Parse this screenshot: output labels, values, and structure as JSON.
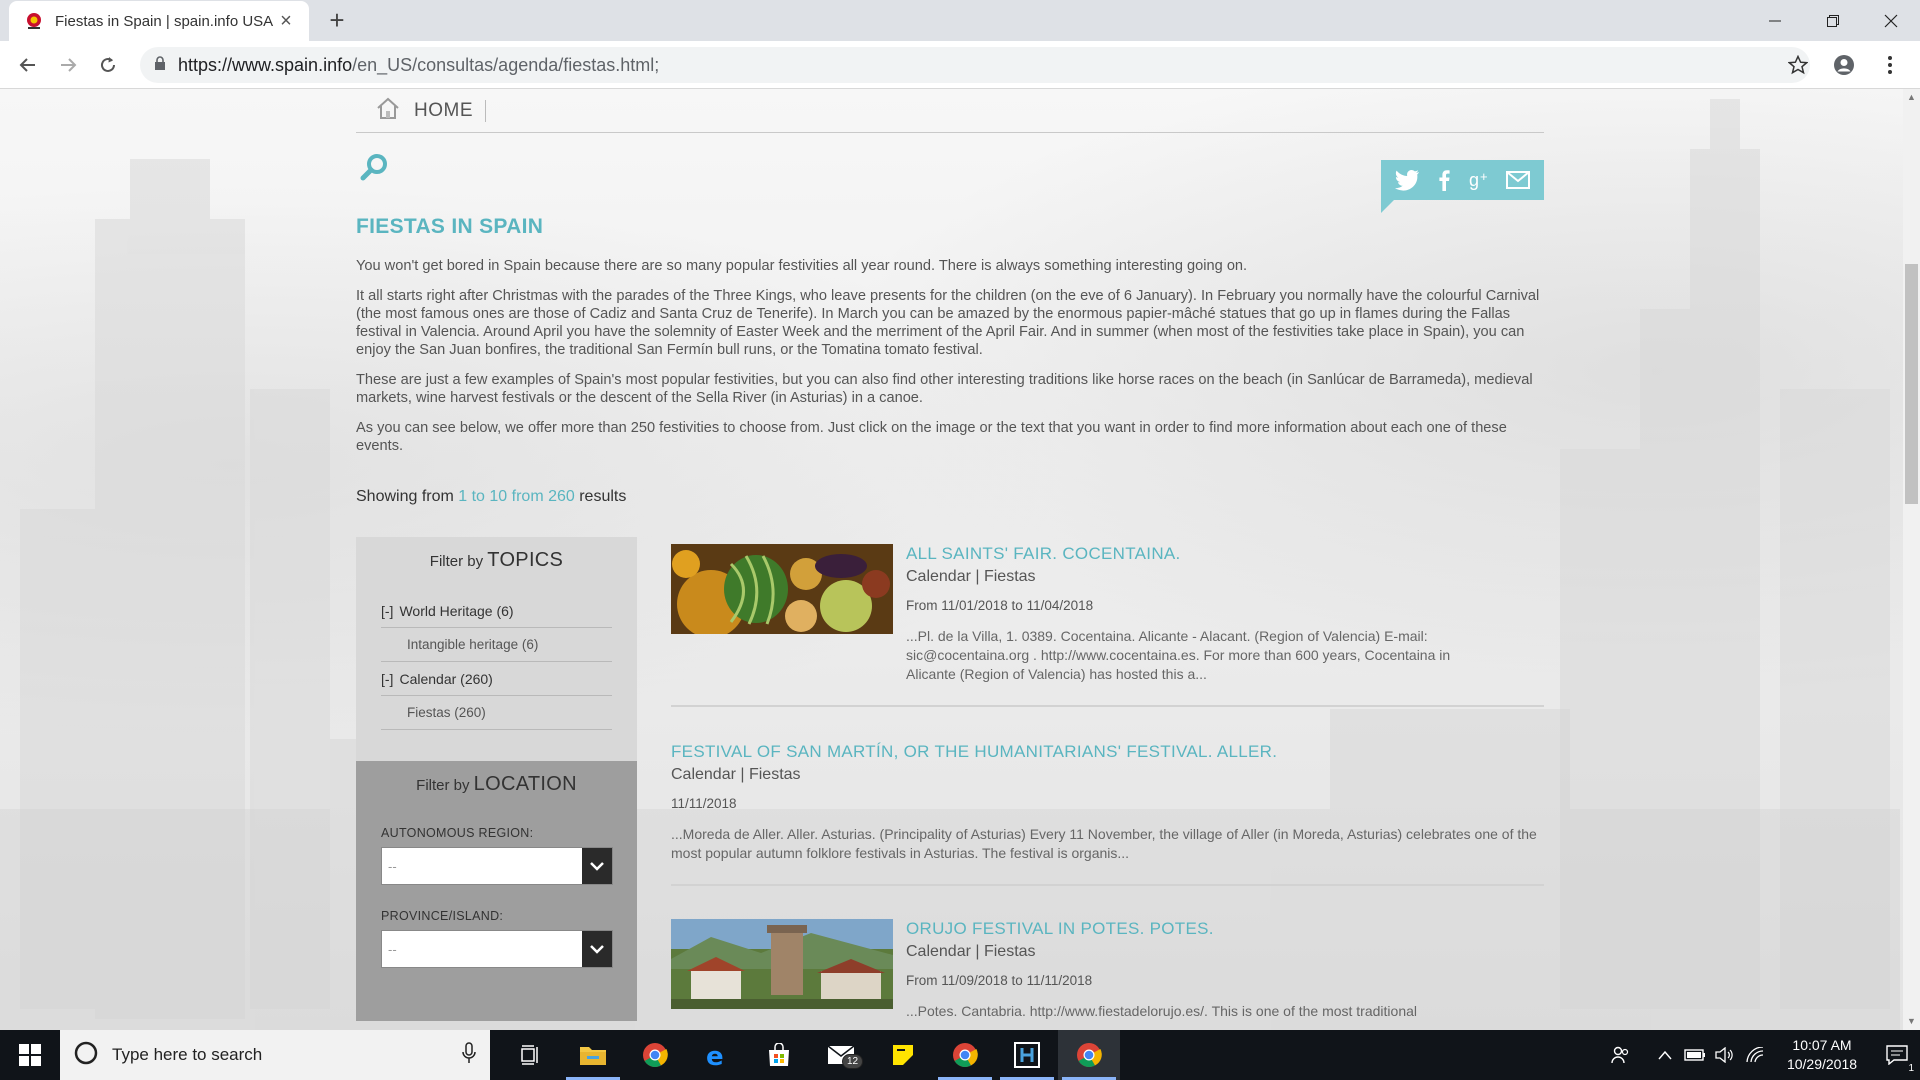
{
  "browser": {
    "tab_title": "Fiestas in Spain | spain.info USA",
    "new_tab_symbol": "+",
    "url_host": "https://www.spain.info",
    "url_path": "/en_US/consultas/agenda/fiestas.html;"
  },
  "nav": {
    "home_label": "HOME"
  },
  "page": {
    "title": "FIESTAS IN SPAIN",
    "paragraphs": [
      "You won't get bored in Spain because there are so many popular festivities all year round. There is always something interesting going on.",
      "It all starts right after Christmas with the parades of the Three Kings, who leave presents for the children (on the eve of 6 January). In February you normally have the colourful Carnival (the most famous ones are those of Cadiz and Santa Cruz de Tenerife). In March you can be amazed by the enormous papier-mâché statues that go up in flames during the Fallas festival in Valencia. Around April you have the solemnity of Easter Week and the merriment of the April Fair. And in summer (when most of the festivities take place in Spain), you can enjoy the San Juan bonfires, the traditional San Fermín bull runs, or the Tomatina tomato festival.",
      "These are just a few examples of Spain's most popular festivities, but you can also find other interesting traditions like horse races on the beach (in Sanlúcar de Barrameda), medieval markets, wine harvest festivals or the descent of the Sella River (in Asturias) in a canoe.",
      "As you can see below, we offer more than 250 festivities to choose from. Just click on the image or the text that you want in order to find more information about each one of these events."
    ],
    "showing_prefix": "Showing from ",
    "showing_range": "1 to 10 from 260",
    "showing_suffix": " results"
  },
  "filters": {
    "topics_prefix": "Filter by ",
    "topics_title": "TOPICS",
    "topic_items": [
      {
        "toggle": "[-]",
        "label": "World Heritage (6)"
      },
      {
        "label": "Intangible heritage (6)"
      },
      {
        "toggle": "[-]",
        "label": "Calendar (260)"
      },
      {
        "label": "Fiestas (260)"
      }
    ],
    "location_prefix": "Filter by ",
    "location_title": "LOCATION",
    "region_label": "AUTONOMOUS REGION:",
    "region_value": "--",
    "province_label": "PROVINCE/ISLAND:",
    "province_value": "--"
  },
  "results": [
    {
      "title": "ALL SAINTS' FAIR. COCENTAINA.",
      "category": "Calendar  |  Fiestas",
      "date": "From 11/01/2018 to 11/04/2018",
      "text": "...Pl. de la Villa, 1. 0389. Cocentaina. Alicante - Alacant. (Region of Valencia) E-mail: sic@cocentaina.org . http://www.cocentaina.es. For more than 600 years, Cocentaina in Alicante (Region of Valencia) has hosted this a..."
    },
    {
      "title": "FESTIVAL OF SAN MARTÍN, OR THE HUMANITARIANS' FESTIVAL. ALLER.",
      "category": "Calendar  |  Fiestas",
      "date": "11/11/2018",
      "text": "...Moreda de Aller. Aller. Asturias. (Principality of Asturias) Every 11 November, the village of Aller (in Moreda, Asturias) celebrates one of the most popular autumn folklore festivals in Asturias. The festival is organis..."
    },
    {
      "title": "ORUJO FESTIVAL IN POTES. POTES.",
      "category": "Calendar  |  Fiestas",
      "date": "From 11/09/2018 to 11/11/2018",
      "text": "...Potes. Cantabria. http://www.fiestadelorujo.es/. This is one of the most traditional"
    }
  ],
  "taskbar": {
    "search_placeholder": "Type here to search",
    "mail_badge": "12",
    "time": "10:07 AM",
    "date": "10/29/2018",
    "notification_count": "1"
  },
  "colors": {
    "accent": "#5ab5c0",
    "share_bg": "#7ecad2",
    "topics_bg": "#d8d8d8",
    "location_bg": "#9e9e9e"
  }
}
